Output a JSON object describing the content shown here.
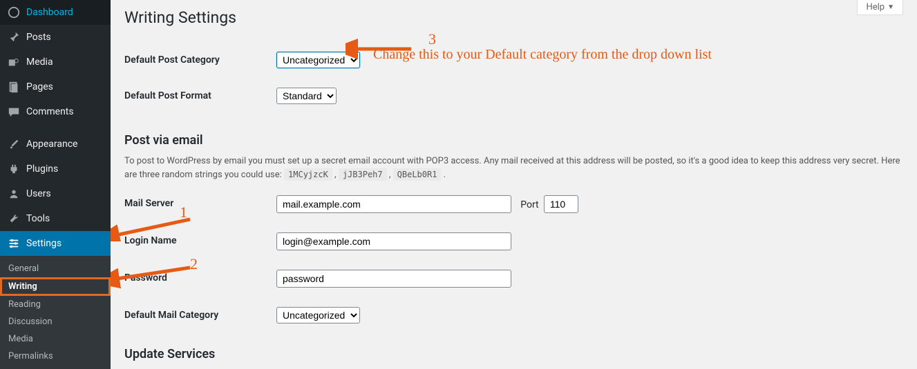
{
  "help_tab": "Help",
  "sidebar": {
    "items": [
      {
        "label": "Dashboard",
        "icon": "dash"
      },
      {
        "label": "Posts",
        "icon": "pin"
      },
      {
        "label": "Media",
        "icon": "media"
      },
      {
        "label": "Pages",
        "icon": "pages"
      },
      {
        "label": "Comments",
        "icon": "comments"
      },
      {
        "label": "Appearance",
        "icon": "brush"
      },
      {
        "label": "Plugins",
        "icon": "plug"
      },
      {
        "label": "Users",
        "icon": "users"
      },
      {
        "label": "Tools",
        "icon": "wrench"
      },
      {
        "label": "Settings",
        "icon": "sliders",
        "active": true
      }
    ],
    "submenu": [
      {
        "label": "General"
      },
      {
        "label": "Writing",
        "current": true
      },
      {
        "label": "Reading"
      },
      {
        "label": "Discussion"
      },
      {
        "label": "Media"
      },
      {
        "label": "Permalinks"
      }
    ]
  },
  "page": {
    "title": "Writing Settings",
    "fields": {
      "default_category": {
        "label": "Default Post Category",
        "value": "Uncategorized"
      },
      "default_format": {
        "label": "Default Post Format",
        "value": "Standard"
      }
    },
    "post_via_email": {
      "heading": "Post via email",
      "desc_before": "To post to WordPress by email you must set up a secret email account with POP3 access. Any mail received at this address will be posted, so it's a good idea to keep this address very secret. Here are three random strings you could use: ",
      "rand": [
        "1MCyjzcK",
        "jJB3Peh7",
        "QBeLb0R1"
      ],
      "mail_server": {
        "label": "Mail Server",
        "value": "mail.example.com",
        "port_label": "Port",
        "port_value": "110"
      },
      "login_name": {
        "label": "Login Name",
        "value": "login@example.com"
      },
      "password": {
        "label": "Password",
        "value": "password"
      },
      "mail_category": {
        "label": "Default Mail Category",
        "value": "Uncategorized"
      }
    },
    "update_services": {
      "heading": "Update Services"
    }
  },
  "annotations": {
    "n1": "1",
    "n2": "2",
    "n3": "3",
    "text3": "Change this to your Default category from the drop down list"
  }
}
